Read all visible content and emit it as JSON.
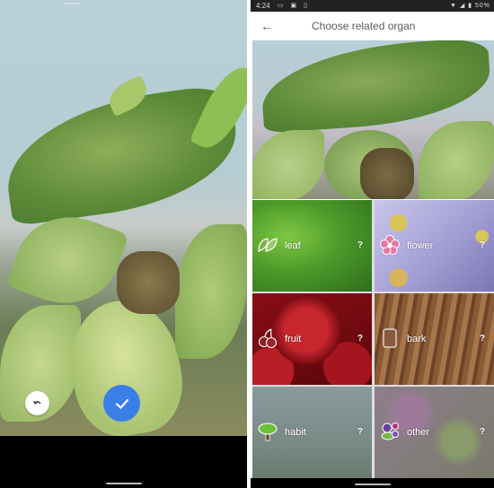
{
  "left_screen": {
    "undo_icon": "undo-icon",
    "confirm_icon": "check-icon"
  },
  "right_screen": {
    "status_bar": {
      "time": "4:24",
      "left_icons": "▭ ▣ ▯",
      "battery": "50%"
    },
    "app_bar": {
      "back_icon": "←",
      "title": "Choose related organ"
    },
    "organs": [
      {
        "label": "leaf",
        "help": "?",
        "icon": "leaf-icon"
      },
      {
        "label": "flower",
        "help": "?",
        "icon": "flower-icon"
      },
      {
        "label": "fruit",
        "help": "?",
        "icon": "fruit-icon"
      },
      {
        "label": "bark",
        "help": "?",
        "icon": "bark-icon"
      },
      {
        "label": "habit",
        "help": "?",
        "icon": "tree-icon"
      },
      {
        "label": "other",
        "help": "?",
        "icon": "other-icon"
      }
    ]
  },
  "colors": {
    "confirm_blue": "#3a7ee8"
  }
}
